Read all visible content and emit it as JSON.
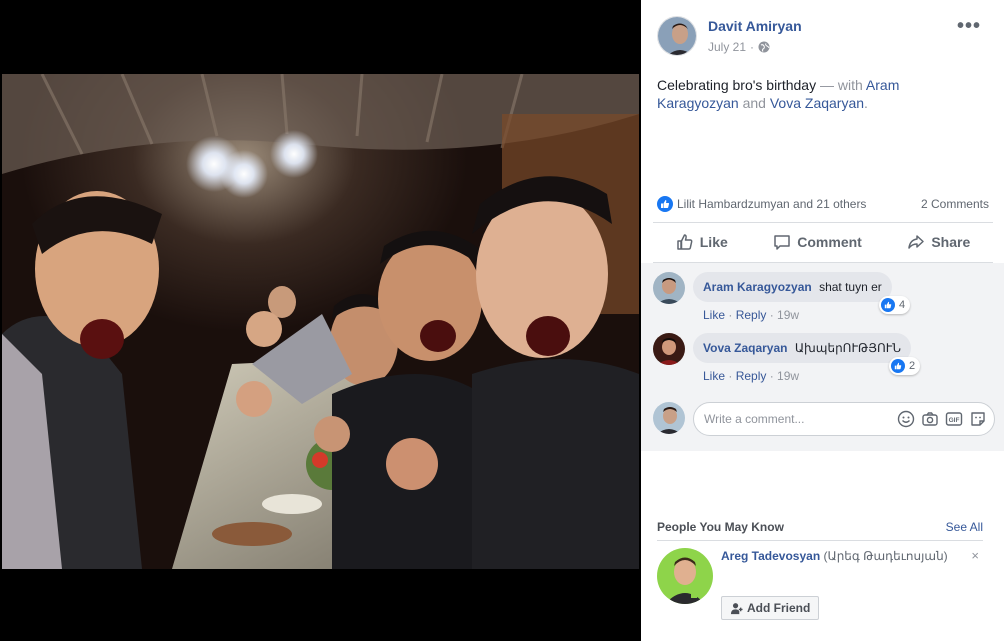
{
  "post": {
    "author": "Davit Amiryan",
    "date": "July 21",
    "privacy_sep": "·",
    "text_main": "Celebrating bro's birthday",
    "text_with": "— with",
    "tag1": "Aram Karagyozyan",
    "text_and": "and",
    "tag2": "Vova Zaqaryan",
    "text_end": "."
  },
  "reactions": {
    "summary": "Lilit Hambardzumyan and 21 others",
    "comments_count": "2 Comments"
  },
  "actions": {
    "like": "Like",
    "comment": "Comment",
    "share": "Share"
  },
  "comments": [
    {
      "name": "Aram Karagyozyan",
      "text": "shat tuyn er",
      "like_label": "Like",
      "reply_label": "Reply",
      "time": "19w",
      "reactions": "4"
    },
    {
      "name": "Vova Zaqaryan",
      "text": "ԱխպերՈՒԹՅՈՒՆ",
      "like_label": "Like",
      "reply_label": "Reply",
      "time": "19w",
      "reactions": "2"
    }
  ],
  "composer": {
    "placeholder": "Write a comment..."
  },
  "pymk": {
    "title": "People You May Know",
    "see_all": "See All",
    "person_name": "Areg Tadevosyan",
    "person_alt": "(Արեգ Թադեւոսյան)",
    "add_friend": "Add Friend",
    "close": "×"
  },
  "colors": {
    "link": "#365899",
    "like_blue": "#1877f2",
    "muted": "#90949c"
  }
}
